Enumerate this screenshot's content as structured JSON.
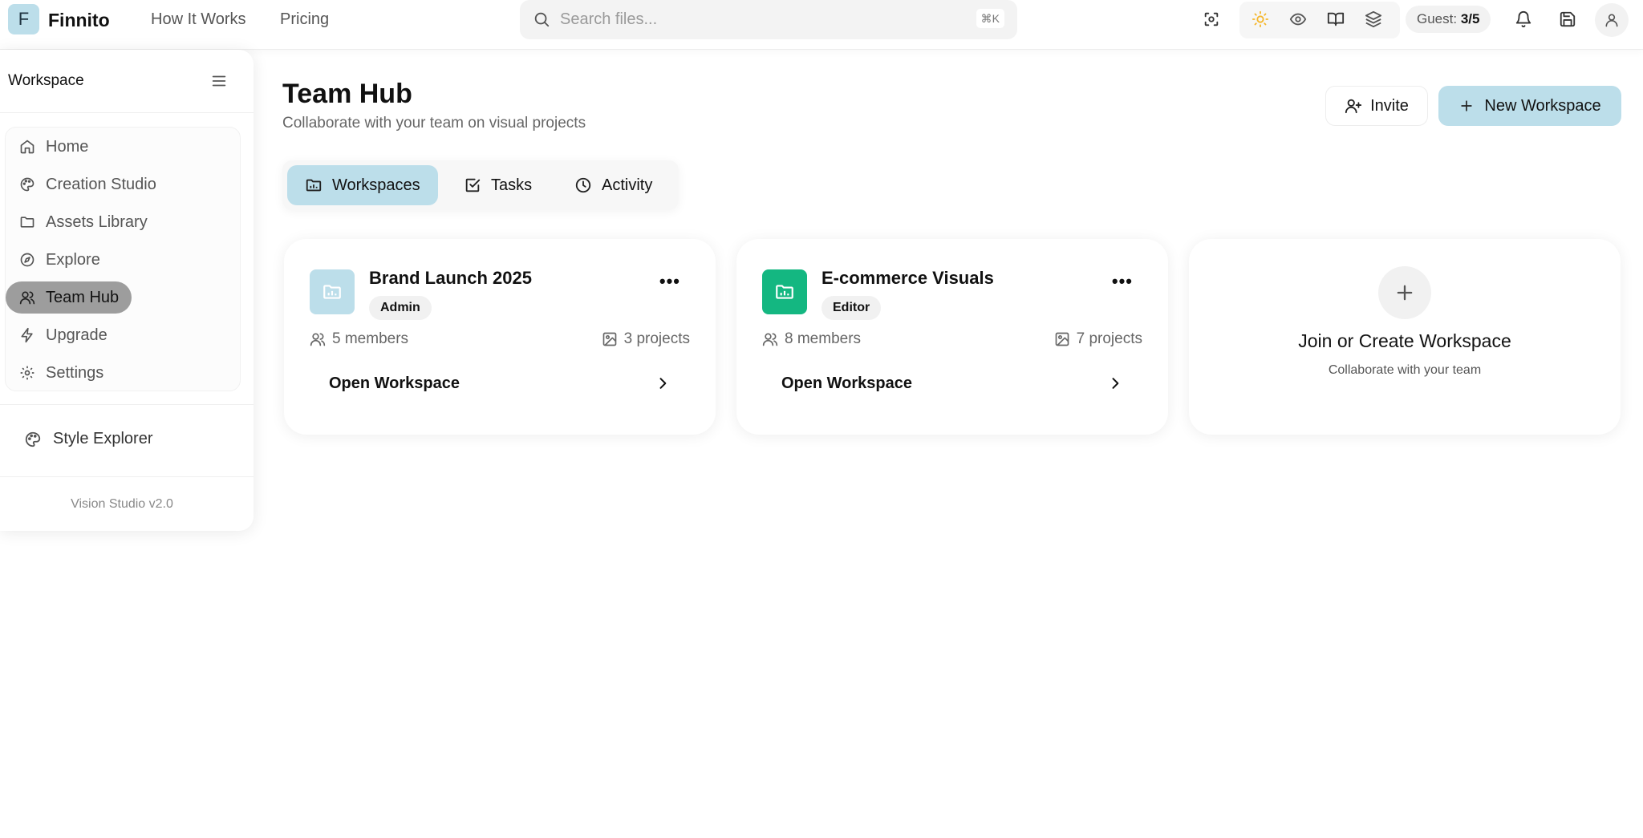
{
  "app": {
    "logo_letter": "F",
    "brand": "Finnito"
  },
  "topnav": {
    "how_it_works": "How It Works",
    "pricing": "Pricing"
  },
  "search": {
    "placeholder": "Search files...",
    "shortcut": "⌘K"
  },
  "guest": {
    "label": "Guest:",
    "value": "3/5"
  },
  "colors": {
    "accent": "#bcdeea",
    "green": "#14b781",
    "sun": "#f5b62a",
    "active_nav": "#9d9d9d"
  },
  "sidebar": {
    "title": "Workspace",
    "items": [
      {
        "label": "Home",
        "icon": "home-icon"
      },
      {
        "label": "Creation Studio",
        "icon": "palette-icon"
      },
      {
        "label": "Assets Library",
        "icon": "folder-icon"
      },
      {
        "label": "Explore",
        "icon": "compass-icon"
      },
      {
        "label": "Team Hub",
        "icon": "users-icon"
      },
      {
        "label": "Upgrade",
        "icon": "zap-icon"
      },
      {
        "label": "Settings",
        "icon": "gear-icon"
      }
    ],
    "style_explorer": "Style Explorer",
    "version": "Vision Studio v2.0"
  },
  "main": {
    "title": "Team Hub",
    "subtitle": "Collaborate with your team on visual projects",
    "invite_label": "Invite",
    "new_workspace_label": "New Workspace",
    "tabs": [
      {
        "label": "Workspaces"
      },
      {
        "label": "Tasks"
      },
      {
        "label": "Activity"
      }
    ],
    "workspaces": [
      {
        "name": "Brand Launch 2025",
        "role": "Admin",
        "members": "5 members",
        "projects": "3 projects",
        "open_label": "Open Workspace"
      },
      {
        "name": "E-commerce Visuals",
        "role": "Editor",
        "members": "8 members",
        "projects": "7 projects",
        "open_label": "Open Workspace"
      }
    ],
    "join": {
      "title": "Join or Create Workspace",
      "subtitle": "Collaborate with your team"
    }
  }
}
